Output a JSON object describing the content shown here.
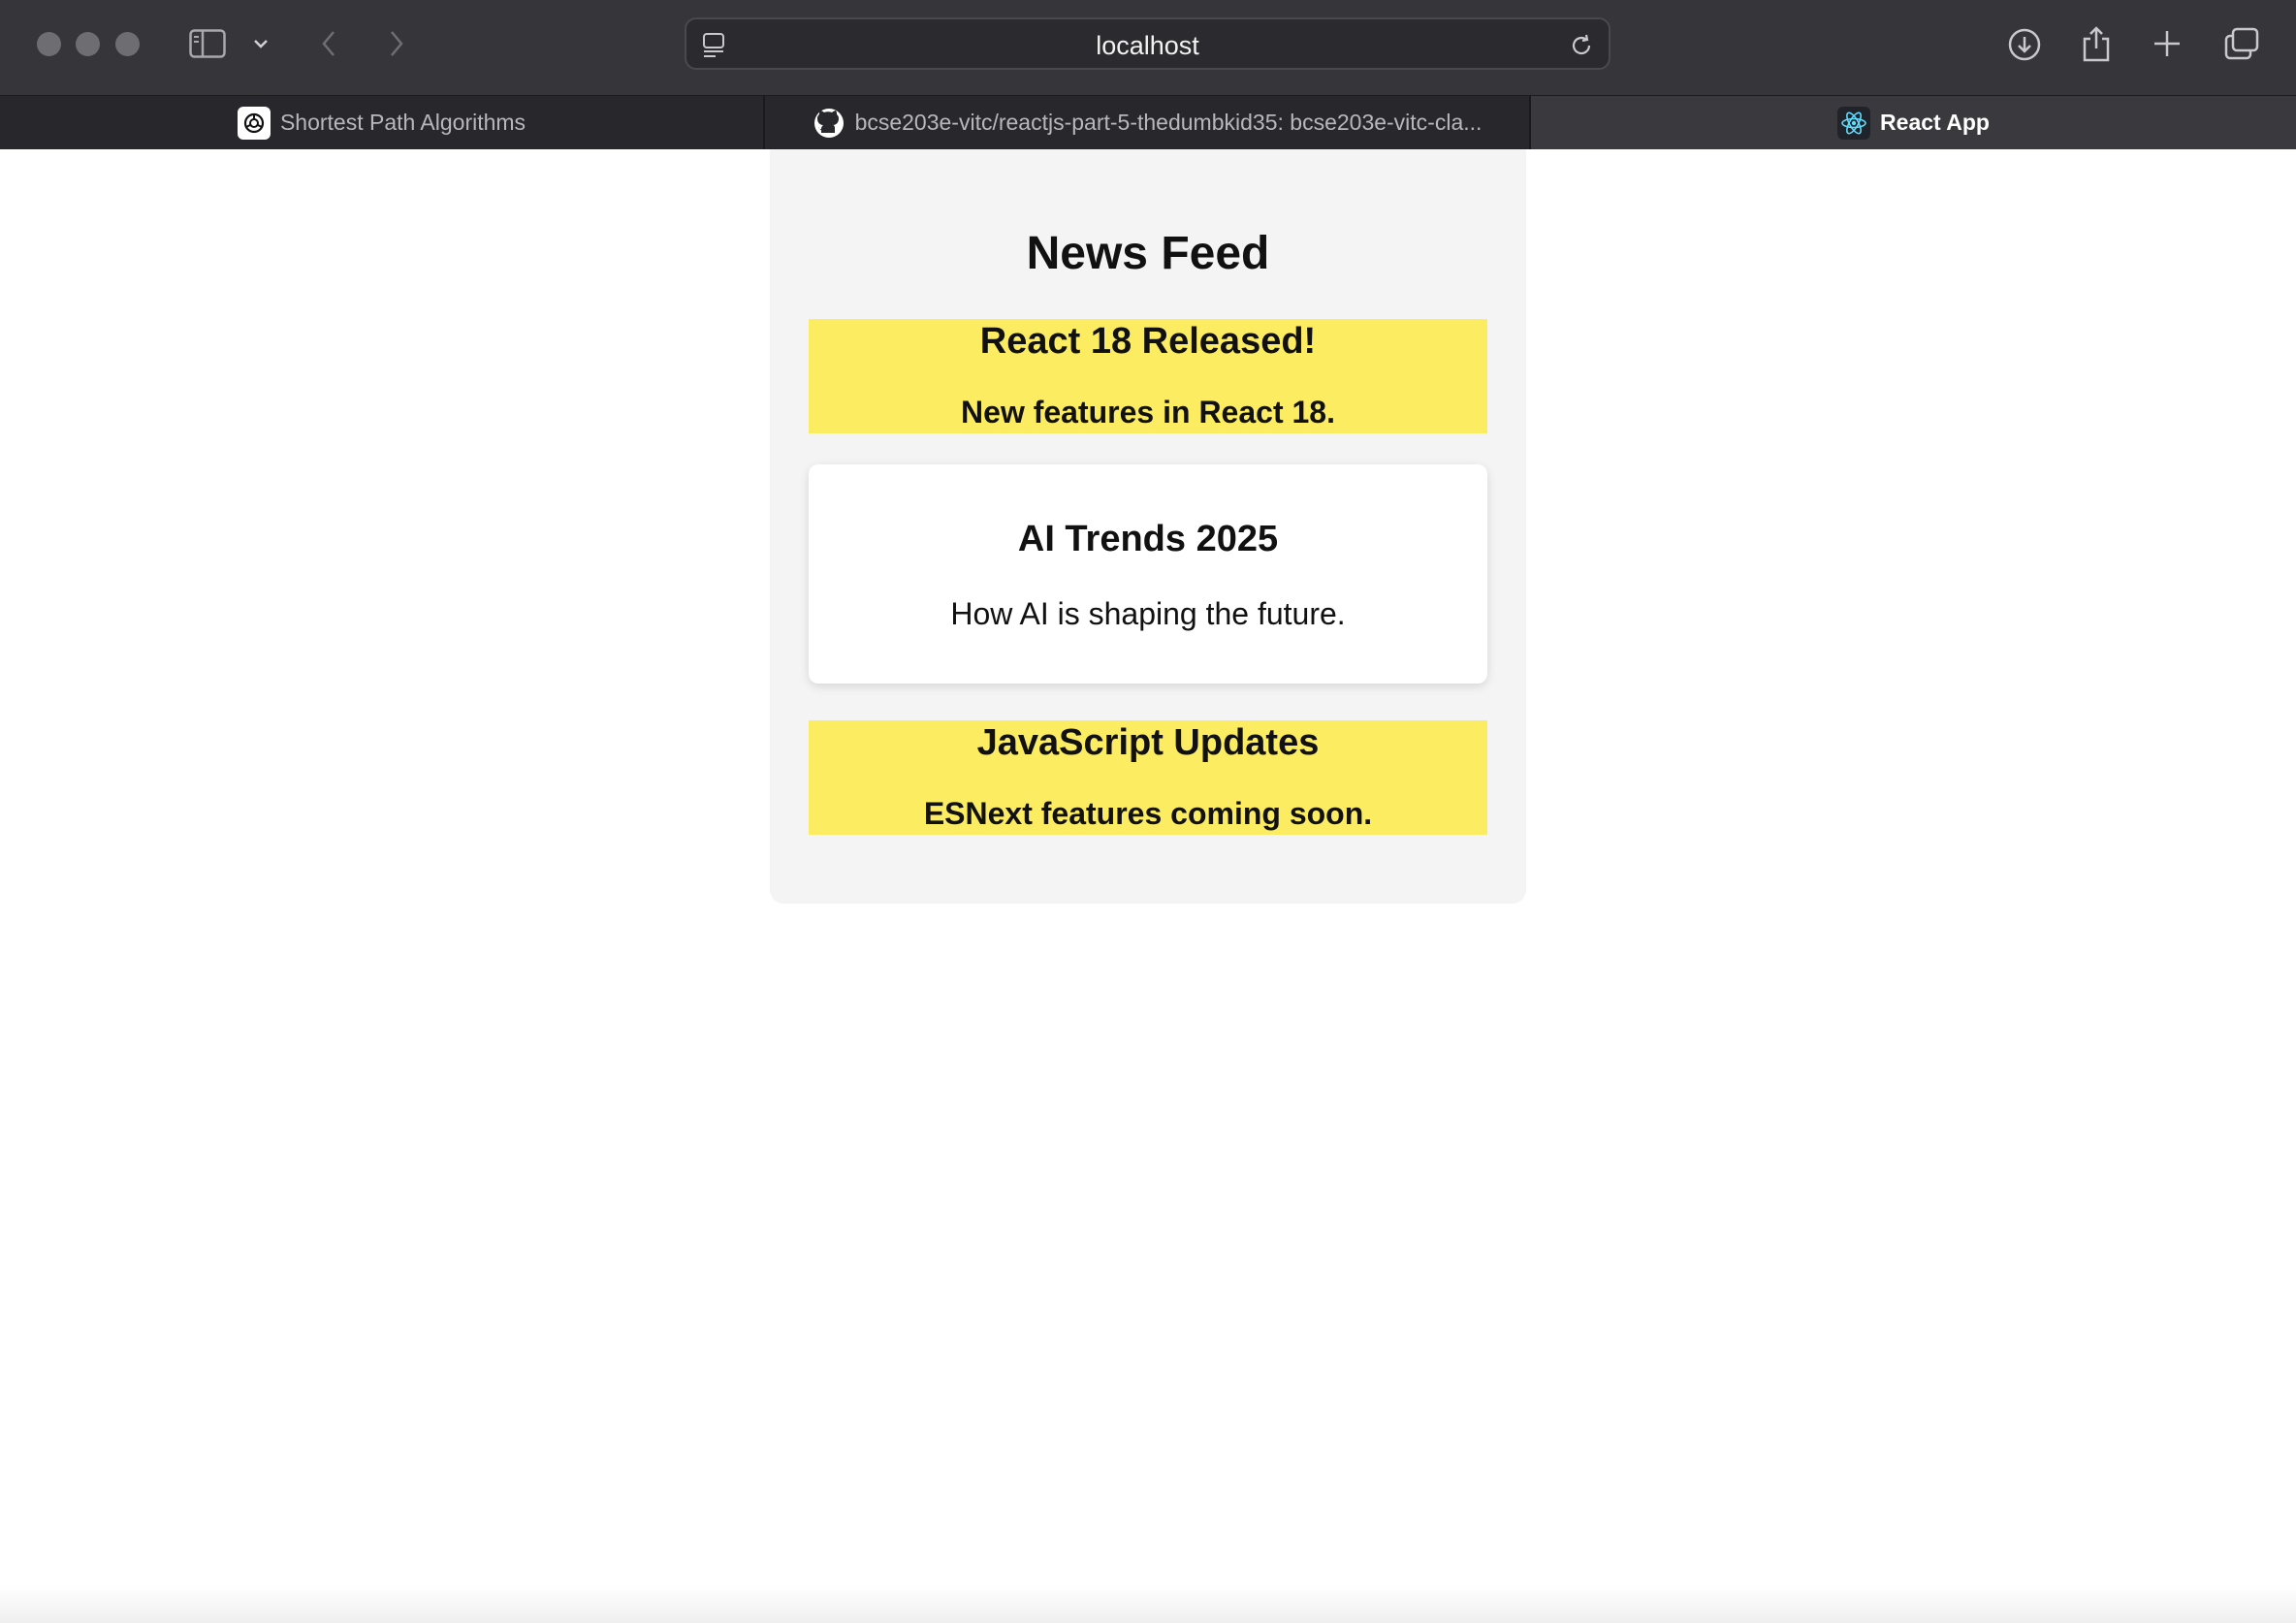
{
  "browser": {
    "url": "localhost",
    "tabs": [
      {
        "label": "Shortest Path Algorithms",
        "icon": "openai-icon",
        "active": false
      },
      {
        "label": "bcse203e-vitc/reactjs-part-5-thedumbkid35: bcse203e-vitc-cla...",
        "icon": "github-icon",
        "active": false
      },
      {
        "label": "React App",
        "icon": "react-icon",
        "active": true
      }
    ]
  },
  "feed": {
    "title": "News Feed",
    "items": [
      {
        "title": "React 18 Released!",
        "description": "New features in React 18.",
        "style": "highlight"
      },
      {
        "title": "AI Trends 2025",
        "description": "How AI is shaping the future.",
        "style": "plain"
      },
      {
        "title": "JavaScript Updates",
        "description": "ESNext features coming soon.",
        "style": "highlight"
      }
    ]
  },
  "colors": {
    "highlight": "#fcec62",
    "feed_background": "#f4f4f4",
    "toolbar": "#36353a"
  }
}
